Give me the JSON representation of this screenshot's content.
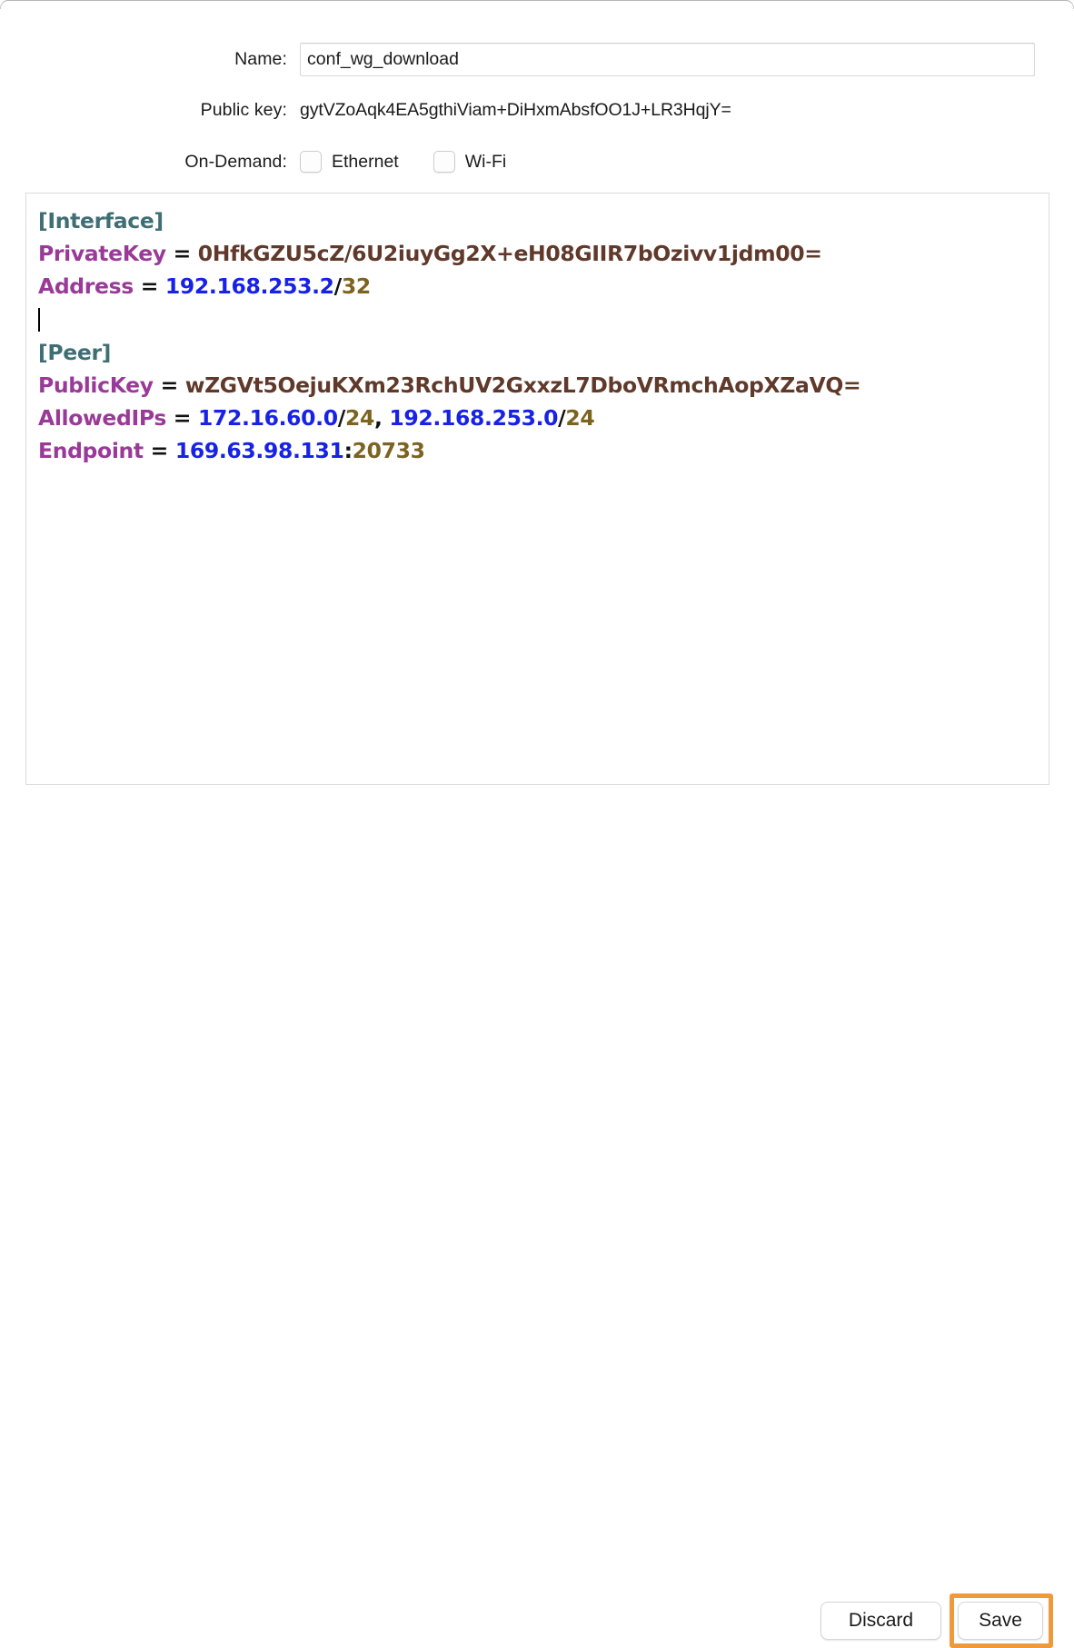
{
  "window": {
    "kind": "tunnel-edit-dialog"
  },
  "form": {
    "name_label": "Name:",
    "name_value": "conf_wg_download",
    "name_placeholder": "",
    "public_key_label": "Public key:",
    "public_key_value": "gytVZoAqk4EA5gthiViam+DiHxmAbsfOO1J+LR3HqjY=",
    "on_demand_label": "On-Demand:",
    "on_demand": [
      {
        "label": "Ethernet",
        "checked": false
      },
      {
        "label": "Wi-Fi",
        "checked": false
      }
    ]
  },
  "config": {
    "interface_section": "[Interface]",
    "private_key_name": "PrivateKey",
    "private_key_eq": " = ",
    "private_key_value": "0HfkGZU5cZ/6U2iuyGg2X+eH08GIIR7bOzivv1jdm00=",
    "address_name": "Address",
    "address_eq": " = ",
    "address_ip": "192.168.253.2",
    "address_slash": "/",
    "address_prefix": "32",
    "peer_section": "[Peer]",
    "public_key_name": "PublicKey",
    "public_key_eq": " = ",
    "public_key_value": "wZGVt5OejuKXm23RchUV2GxxzL7DboVRmchAopXZaVQ=",
    "allowed_ips_name": "AllowedIPs",
    "allowed_ips_eq": " = ",
    "allowed_ips_ip1": "172.16.60.0",
    "allowed_ips_slash1": "/",
    "allowed_ips_prefix1": "24",
    "allowed_ips_sep": ", ",
    "allowed_ips_ip2": "192.168.253.0",
    "allowed_ips_slash2": "/",
    "allowed_ips_prefix2": "24",
    "endpoint_name": "Endpoint",
    "endpoint_eq": " = ",
    "endpoint_host": "169.63.98.131",
    "endpoint_colon": ":",
    "endpoint_port": "20733"
  },
  "footer": {
    "discard_label": "Discard",
    "save_label": "Save"
  },
  "colors": {
    "highlight": "#ee9a3c",
    "section": "#3f6e74",
    "key": "#9a3a98",
    "base64": "#60392a",
    "ip": "#1822e6",
    "number": "#7c6320"
  }
}
